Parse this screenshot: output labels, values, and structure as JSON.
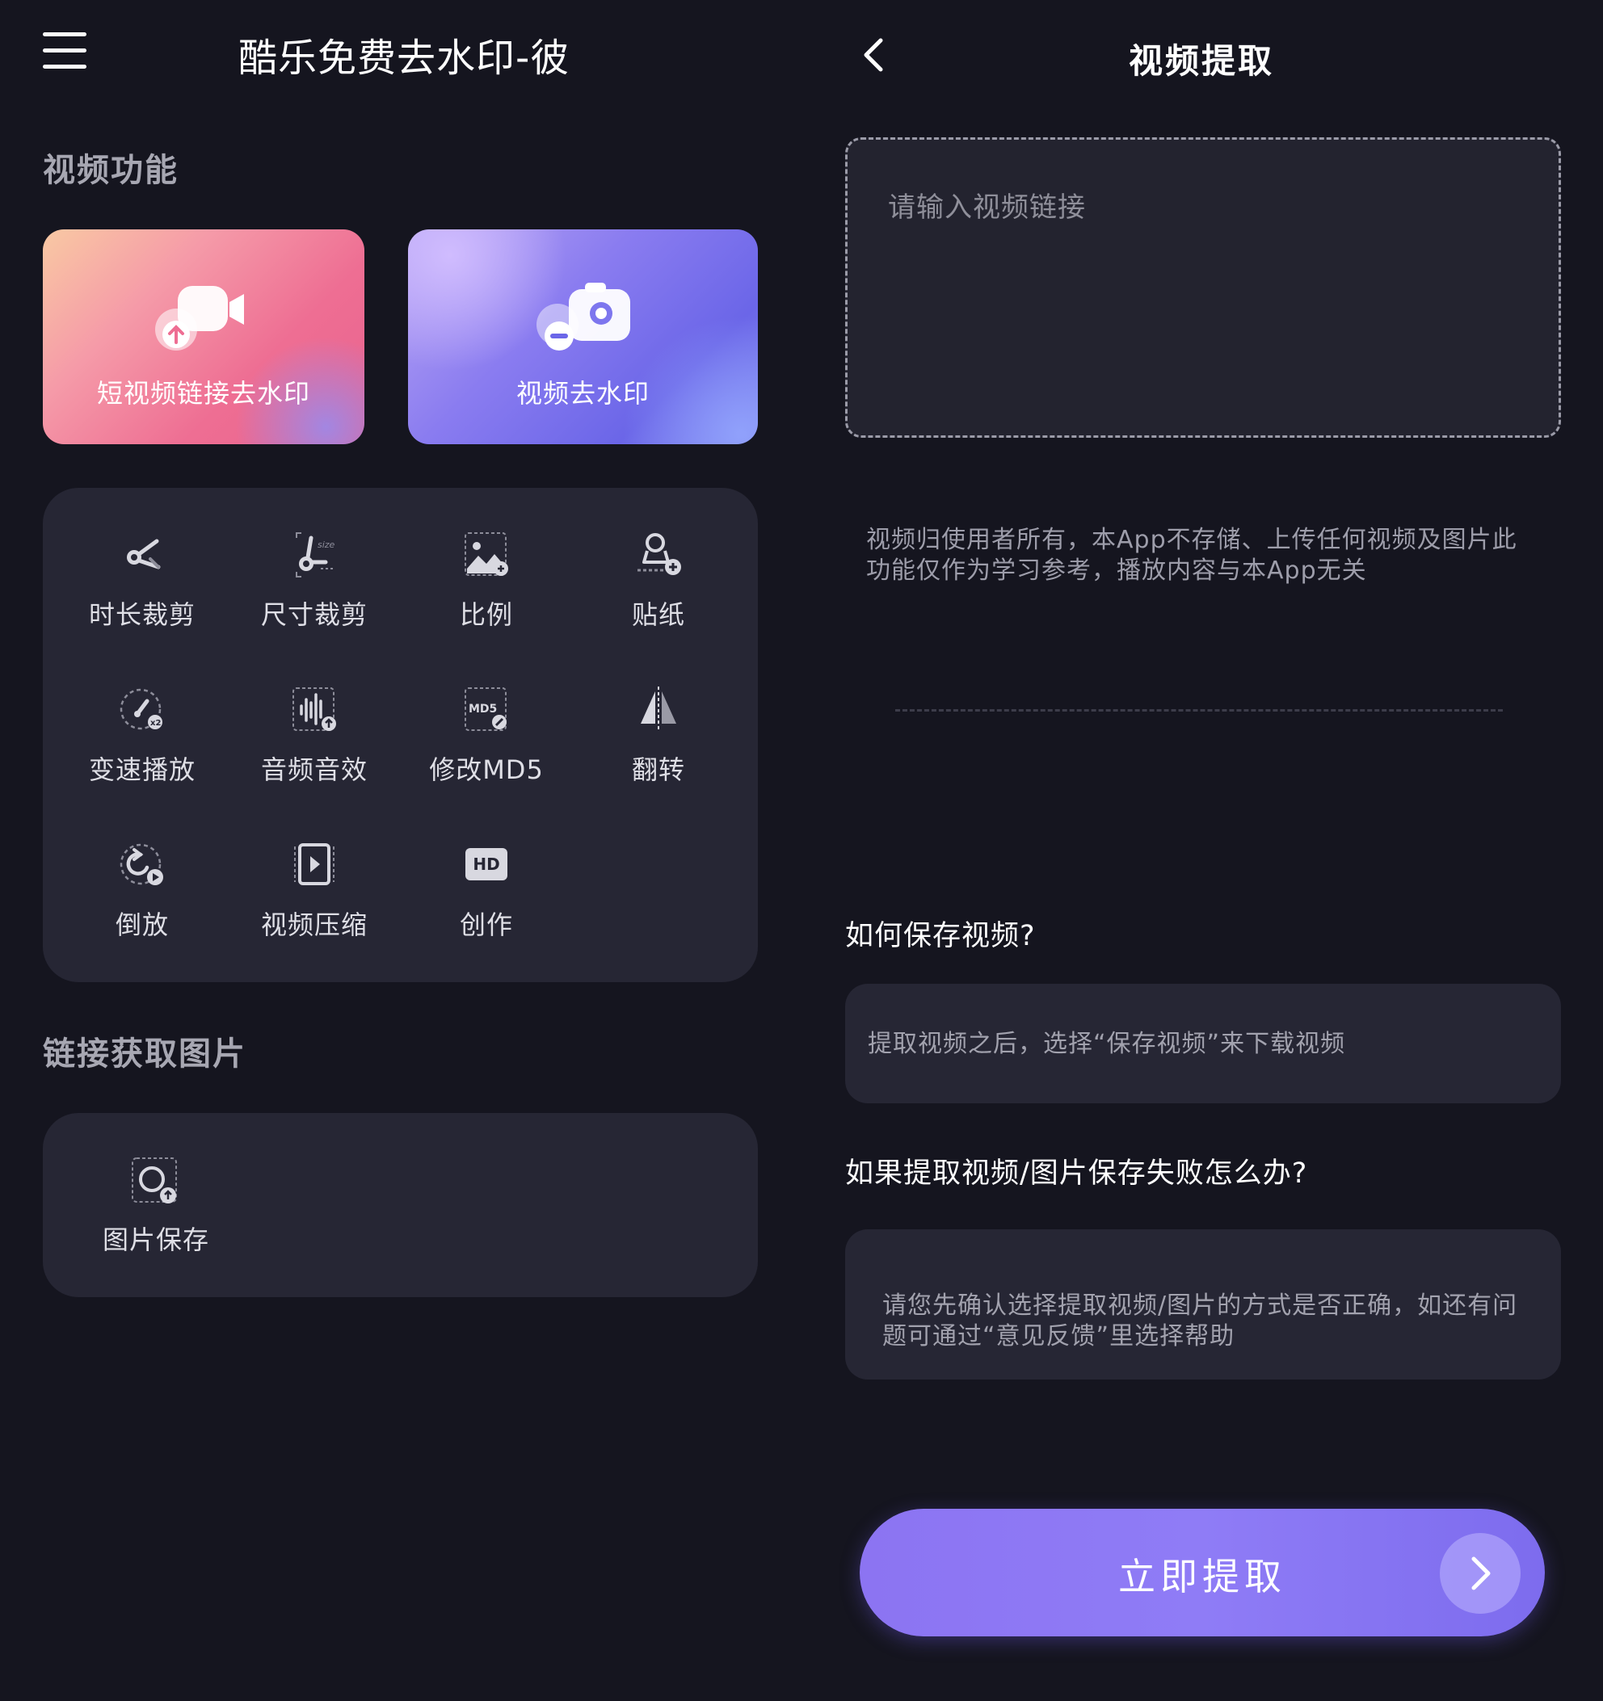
{
  "left": {
    "app_title": "酷乐免费去水印-彼",
    "video_section_title": "视频功能",
    "feature_cards": [
      {
        "label": "短视频链接去水印",
        "icon": "video-camera-upload-icon"
      },
      {
        "label": "视频去水印",
        "icon": "camera-remove-icon"
      }
    ],
    "tools": [
      {
        "label": "时长裁剪",
        "icon": "scissors-icon"
      },
      {
        "label": "尺寸裁剪",
        "icon": "resize-crop-icon"
      },
      {
        "label": "比例",
        "icon": "image-ratio-icon"
      },
      {
        "label": "贴纸",
        "icon": "sticker-icon"
      },
      {
        "label": "变速播放",
        "icon": "speed-gauge-icon"
      },
      {
        "label": "音频音效",
        "icon": "audio-wave-icon"
      },
      {
        "label": "修改MD5",
        "icon": "md5-icon"
      },
      {
        "label": "翻转",
        "icon": "flip-icon"
      },
      {
        "label": "倒放",
        "icon": "reverse-play-icon"
      },
      {
        "label": "视频压缩",
        "icon": "compress-video-icon"
      },
      {
        "label": "创作",
        "icon": "hd-icon",
        "badge": "HD"
      }
    ],
    "image_section_title": "链接获取图片",
    "image_tools": [
      {
        "label": "图片保存",
        "icon": "image-save-icon"
      }
    ]
  },
  "right": {
    "page_title": "视频提取",
    "link_input": {
      "placeholder": "请输入视频链接",
      "value": ""
    },
    "disclaimer": "视频归使用者所有，本App不存储、上传任何视频及图片此功能仅作为学习参考，播放内容与本App无关",
    "faq": [
      {
        "question": "如何保存视频?",
        "answer": "提取视频之后，选择“保存视频”来下载视频"
      },
      {
        "question": "如果提取视频/图片保存失败怎么办?",
        "answer": "请您先确认选择提取视频/图片的方式是否正确，如还有问题可通过“意见反馈”里选择帮助"
      }
    ],
    "extract_button": "立即提取"
  },
  "colors": {
    "background": "#15151f",
    "card_background": "#262634",
    "accent_purple": "#8c74f2",
    "pink_card": "#ee6e93",
    "purple_card": "#6b66e8"
  }
}
